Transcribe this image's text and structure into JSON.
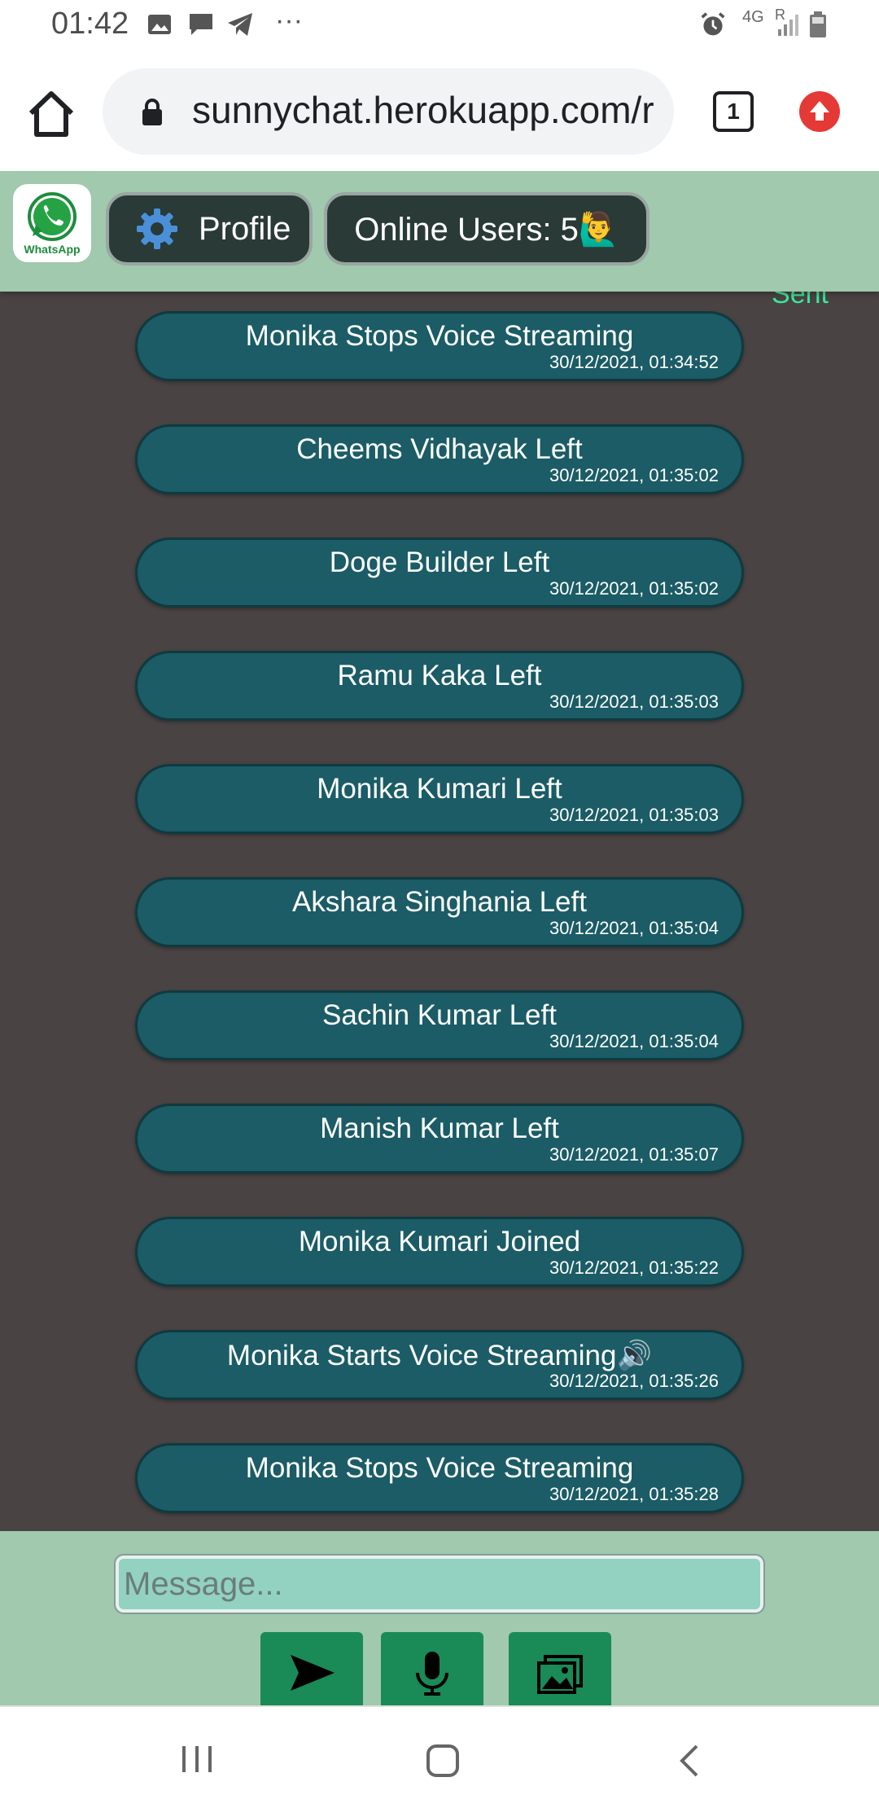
{
  "status_bar": {
    "time": "01:42",
    "network": "4G",
    "roaming": "R",
    "more": "···"
  },
  "browser": {
    "url": "sunnychat.herokuapp.com/r",
    "tab_count": "1"
  },
  "header": {
    "logo_label": "WhatsApp",
    "profile_label": "Profile",
    "online_label": "Online Users: 5🙋‍♂️"
  },
  "chat": {
    "partial_label": "Sent",
    "messages": [
      {
        "text": "Monika Stops Voice Streaming",
        "time": "30/12/2021, 01:34:52"
      },
      {
        "text": "Cheems Vidhayak Left",
        "time": "30/12/2021, 01:35:02"
      },
      {
        "text": "Doge Builder Left",
        "time": "30/12/2021, 01:35:02"
      },
      {
        "text": "Ramu Kaka Left",
        "time": "30/12/2021, 01:35:03"
      },
      {
        "text": "Monika Kumari Left",
        "time": "30/12/2021, 01:35:03"
      },
      {
        "text": "Akshara Singhania Left",
        "time": "30/12/2021, 01:35:04"
      },
      {
        "text": "Sachin Kumar Left",
        "time": "30/12/2021, 01:35:04"
      },
      {
        "text": "Manish Kumar Left",
        "time": "30/12/2021, 01:35:07"
      },
      {
        "text": "Monika Kumari Joined",
        "time": "30/12/2021, 01:35:22"
      },
      {
        "text": "Monika Starts Voice Streaming🔊",
        "time": "30/12/2021, 01:35:26"
      },
      {
        "text": "Monika Stops Voice Streaming",
        "time": "30/12/2021, 01:35:28"
      }
    ]
  },
  "composer": {
    "placeholder": "Message...",
    "value": "",
    "send_icon": "send-icon",
    "mic_icon": "microphone-icon",
    "image_icon": "image-gallery-icon"
  },
  "colors": {
    "header_bg": "#a0c9ad",
    "chat_bg": "#4a4343",
    "bubble_bg": "#1b5c66",
    "button_green": "#1a8a57",
    "sent_label": "#3de69a"
  }
}
